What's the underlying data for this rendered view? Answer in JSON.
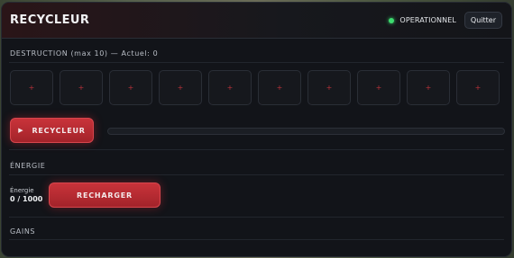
{
  "header": {
    "title": "RECYCLEUR",
    "status_text": "OPERATIONNEL",
    "status_color": "#3ddc6f",
    "quit_label": "Quitter"
  },
  "destruction": {
    "label": "DESTRUCTION (max 10) — Actuel: 0",
    "max": 10,
    "current": 0,
    "slots": [
      "+",
      "+",
      "+",
      "+",
      "+",
      "+",
      "+",
      "+",
      "+",
      "+"
    ]
  },
  "recycle": {
    "button_label": "RECYCLEUR",
    "progress": 0
  },
  "energy": {
    "section_label": "ÉNERGIE",
    "label": "Énergie",
    "value": "0 / 1000",
    "recharge_label": "RECHARGER"
  },
  "gains": {
    "section_label": "GAINS"
  },
  "colors": {
    "accent_red": "#c9333a",
    "panel_bg": "#121419"
  }
}
